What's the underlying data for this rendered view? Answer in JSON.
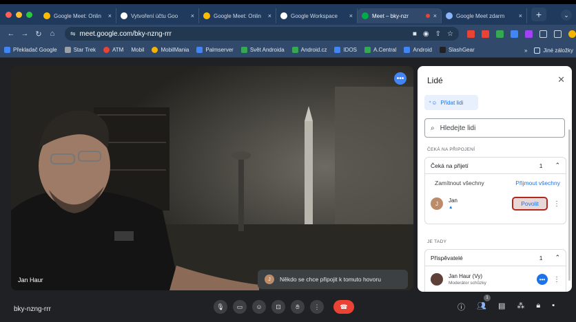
{
  "browser": {
    "traffic_lights": [
      "#ff5f57",
      "#febc2e",
      "#28c840"
    ],
    "tabs": [
      {
        "title": "Google Meet: Onlin",
        "favicon_color": "#fbbc04",
        "active": false
      },
      {
        "title": "Vytvoření účtu Goo",
        "favicon_color": "#ffffff",
        "active": false
      },
      {
        "title": "Google Meet: Onlin",
        "favicon_color": "#fbbc04",
        "active": false
      },
      {
        "title": "Google Workspace",
        "favicon_color": "#ffffff",
        "active": false
      },
      {
        "title": "Meet – bky-nzr",
        "favicon_color": "#00ac47",
        "active": true
      },
      {
        "title": "Google Meet zdarm",
        "favicon_color": "#8ab4f8",
        "active": false
      }
    ],
    "tab_close": "×",
    "new_tab": "+",
    "url": "meet.google.com/bky-nzng-rrr",
    "bookmarks": [
      {
        "label": "Překladač Google",
        "color": "#4285f4"
      },
      {
        "label": "Star Trek",
        "color": "#9aa0a6"
      },
      {
        "label": "ATM",
        "color": "#ea4335"
      },
      {
        "label": "Mobil",
        "color": "#31496a"
      },
      {
        "label": "MobilMania",
        "color": "#f4b400"
      },
      {
        "label": "Palmserver",
        "color": "#4285f4"
      },
      {
        "label": "Svět Androida",
        "color": "#34a853"
      },
      {
        "label": "Android.cz",
        "color": "#34a853"
      },
      {
        "label": "IDOS",
        "color": "#4285f4"
      },
      {
        "label": "A.Central",
        "color": "#34a853"
      },
      {
        "label": "Android",
        "color": "#4285f4"
      },
      {
        "label": "SlashGear",
        "color": "#202124"
      }
    ],
    "bookmarks_more": "»",
    "other_bookmarks": "Jiné záložky"
  },
  "meet": {
    "participant_name": "Jan Haur",
    "toast": {
      "avatar_letter": "J",
      "text": "Někdo se chce připojit k tomuto hovoru"
    },
    "panel": {
      "title": "Lidé",
      "add_people": "Přidat lidi",
      "search_placeholder": "Hledejte lidi",
      "waiting_section": "ČEKÁ NA PŘIPOJENÍ",
      "waiting_group": {
        "label": "Čeká na přijetí",
        "count": "1"
      },
      "deny_all": "Zamítnout všechny",
      "accept_all": "Přijmout všechny",
      "waiting_person": {
        "name": "Jan",
        "avatar_letter": "J",
        "avatar_color": "#bc8b6a",
        "admit": "Povolit"
      },
      "here_section": "JE TADY",
      "contributors_group": {
        "label": "Přispěvatelé",
        "count": "1"
      },
      "host": {
        "name": "Jan Haur (Vy)",
        "role": "Moderátor schůzky",
        "avatar_color": "#5d4037"
      }
    },
    "meeting_code": "bky-nzng-rrr",
    "people_badge": "1",
    "accent": "#1a73e8",
    "hangup_color": "#ea4335"
  }
}
